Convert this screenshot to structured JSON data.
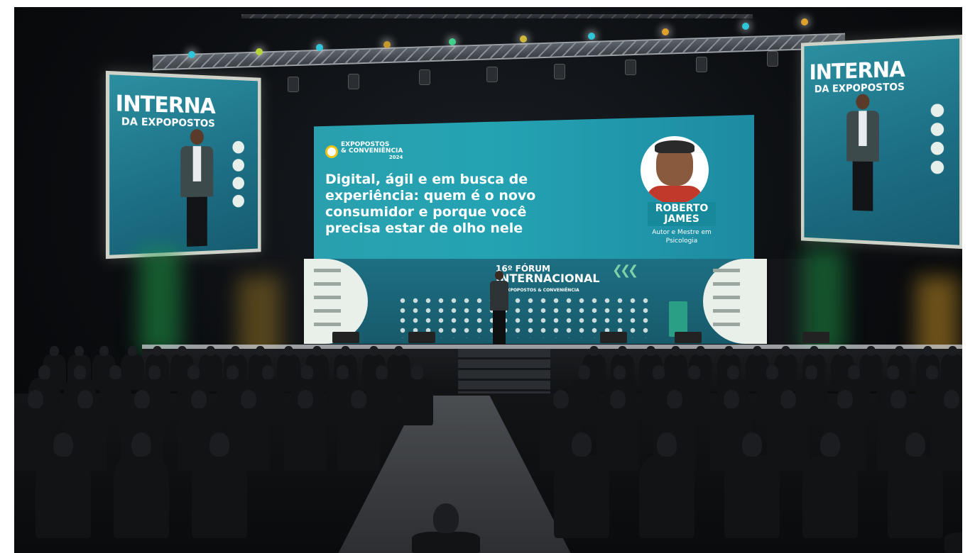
{
  "side_screen_left": {
    "line1": "INTERNA",
    "line2": "DA EXPOPOSTOS"
  },
  "side_screen_right": {
    "line1": "INTERNA",
    "line2": "DA EXPOPOSTOS"
  },
  "center_screen": {
    "logo": {
      "line1": "EXPOPOSTOS",
      "line2": "& CONVENIÊNCIA",
      "year": "2024"
    },
    "headline": "Digital, ágil e em busca de experiência: quem é o novo consumidor e porque você precisa estar de olho nele",
    "speaker_name": "ROBERTO JAMES",
    "speaker_role": "Autor e Mestre em Psicologia"
  },
  "led_wall": {
    "line1": "16º FÓRUM",
    "line2": "INTERNACIONAL",
    "line3": "DA EXPOPOSTOS & CONVENIÊNCIA"
  },
  "colors": {
    "screen_teal": "#24a3b3",
    "stage_green": "#1f9a4a",
    "stage_amber": "#e3a62a"
  }
}
